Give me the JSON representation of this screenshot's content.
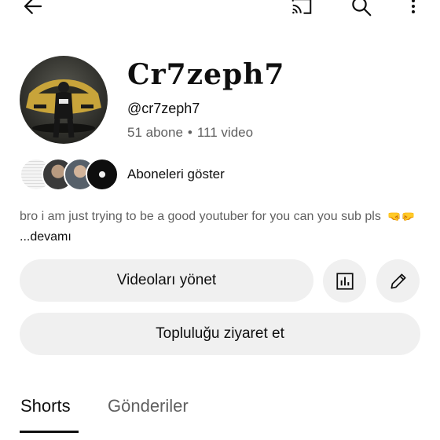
{
  "topbar": {
    "back_icon": "arrow-left-icon",
    "cast_icon": "cast-icon",
    "search_icon": "search-icon",
    "more_icon": "more-vertical-icon"
  },
  "channel": {
    "name": "Cr7zeph7",
    "handle": "@cr7zeph7",
    "subscribers": "51 abone",
    "separator": "•",
    "videos": "111 video"
  },
  "subscribers_preview": {
    "label": "Aboneleri göster"
  },
  "description": {
    "text": "bro i am just trying to be a good youtuber for you can you sub pls",
    "emojis": "🤜🤛",
    "more_label": "...devamı"
  },
  "actions": {
    "manage_videos": "Videoları yönet",
    "analytics_icon": "analytics-icon",
    "edit_icon": "edit-pencil-icon",
    "visit_community": "Topluluğu ziyaret et"
  },
  "tabs": [
    {
      "label": "Shorts",
      "selected": true
    },
    {
      "label": "Gönderiler",
      "selected": false
    }
  ],
  "colors": {
    "background": "#ffffff",
    "button_bg": "#f0f0f0",
    "text_primary": "#0f0f0f",
    "text_secondary": "#606060"
  }
}
